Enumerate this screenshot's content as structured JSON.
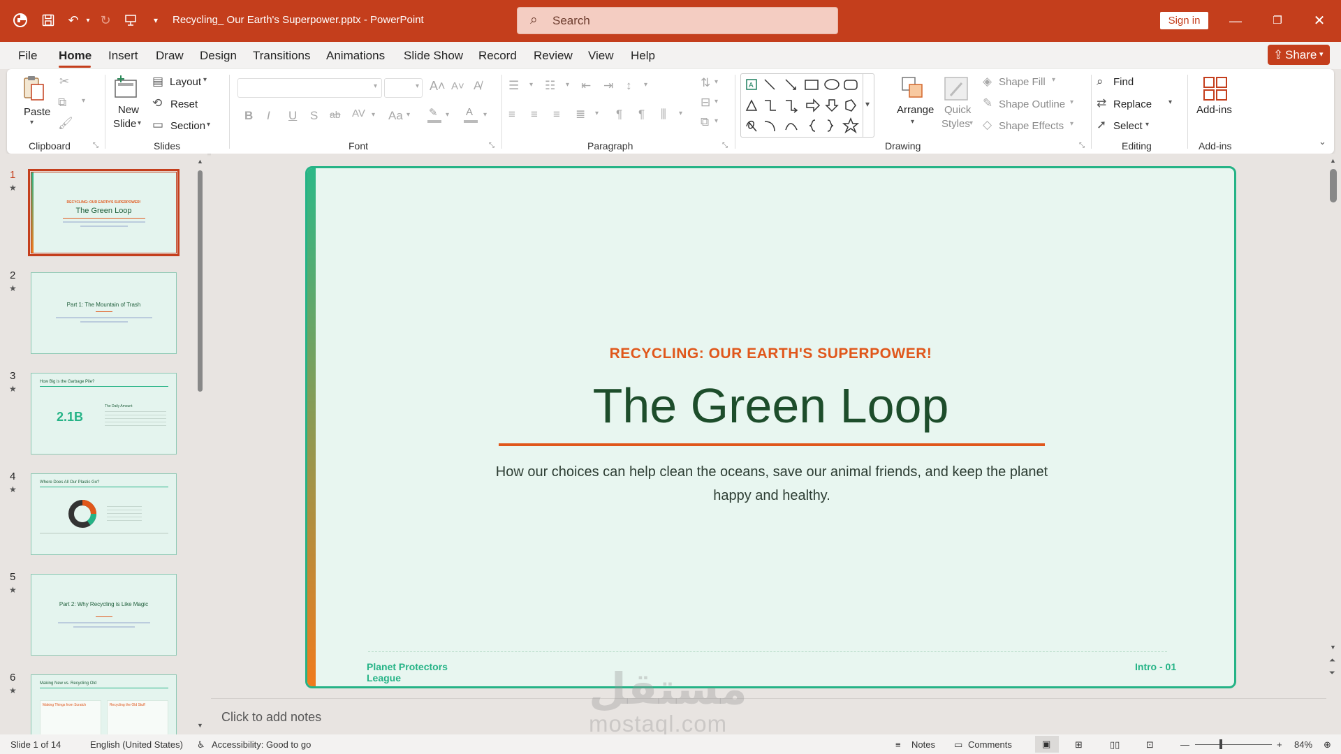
{
  "app": {
    "file_title": "Recycling_ Our Earth's Superpower.pptx",
    "app_name": "PowerPoint",
    "separator": "-"
  },
  "search": {
    "placeholder": "Search"
  },
  "account": {
    "signin": "Sign in"
  },
  "menu": {
    "tabs": [
      "File",
      "Home",
      "Insert",
      "Draw",
      "Design",
      "Transitions",
      "Animations",
      "Slide Show",
      "Record",
      "Review",
      "View",
      "Help"
    ],
    "active": "Home",
    "share": "Share"
  },
  "ribbon": {
    "clipboard": {
      "label": "Clipboard",
      "paste": "Paste"
    },
    "slides": {
      "label": "Slides",
      "new_slide_1": "New",
      "new_slide_2": "Slide",
      "layout": "Layout",
      "reset": "Reset",
      "section": "Section"
    },
    "font": {
      "label": "Font",
      "bold": "B",
      "italic": "I",
      "underline": "U",
      "shadow": "S",
      "strike": "ab",
      "spacing": "AV",
      "case": "Aa",
      "grow": "A",
      "shrink": "A",
      "color": "A"
    },
    "paragraph": {
      "label": "Paragraph"
    },
    "drawing": {
      "label": "Drawing",
      "arrange": "Arrange",
      "quick_styles_1": "Quick",
      "quick_styles_2": "Styles",
      "shape_fill": "Shape Fill",
      "shape_outline": "Shape Outline",
      "shape_effects": "Shape Effects"
    },
    "editing": {
      "label": "Editing",
      "find": "Find",
      "replace": "Replace",
      "select": "Select"
    },
    "addins": {
      "label": "Add-ins",
      "button": "Add-ins"
    }
  },
  "thumbnails": [
    {
      "num": "1",
      "title": "The Green Loop",
      "kicker": "RECYCLING: OUR EARTH'S SUPERPOWER!",
      "selected": true
    },
    {
      "num": "2",
      "title": "Part 1: The Mountain of Trash"
    },
    {
      "num": "3",
      "title": "How Big is the Garbage Pile?",
      "stat": "2.1B",
      "side": "The Daily Amount"
    },
    {
      "num": "4",
      "title": "Where Does All Our Plastic Go?"
    },
    {
      "num": "5",
      "title": "Part 2: Why Recycling is Like Magic"
    },
    {
      "num": "6",
      "title": "Making New vs. Recycling Old",
      "left": "Making Things from Scratch",
      "right": "Recycling the Old Stuff"
    }
  ],
  "slide": {
    "kicker": "RECYCLING: OUR EARTH'S SUPERPOWER!",
    "title": "The Green Loop",
    "subtitle": "How our choices can help clean the oceans, save our animal friends, and keep the planet happy and healthy.",
    "footer_left": "Planet Protectors League",
    "footer_right": "Intro - 01"
  },
  "notes": {
    "placeholder": "Click to add notes"
  },
  "watermark": {
    "arabic": "مستقل",
    "latin": "mostaql.com"
  },
  "status": {
    "slide_of": "Slide 1 of 14",
    "language": "English (United States)",
    "accessibility": "Accessibility: Good to go",
    "notes": "Notes",
    "comments": "Comments",
    "zoom": "84%"
  },
  "colors": {
    "accent": "#c43e1c",
    "slide_green": "#25b386",
    "slide_orange": "#e0571b",
    "slide_title": "#1d4d2b"
  }
}
